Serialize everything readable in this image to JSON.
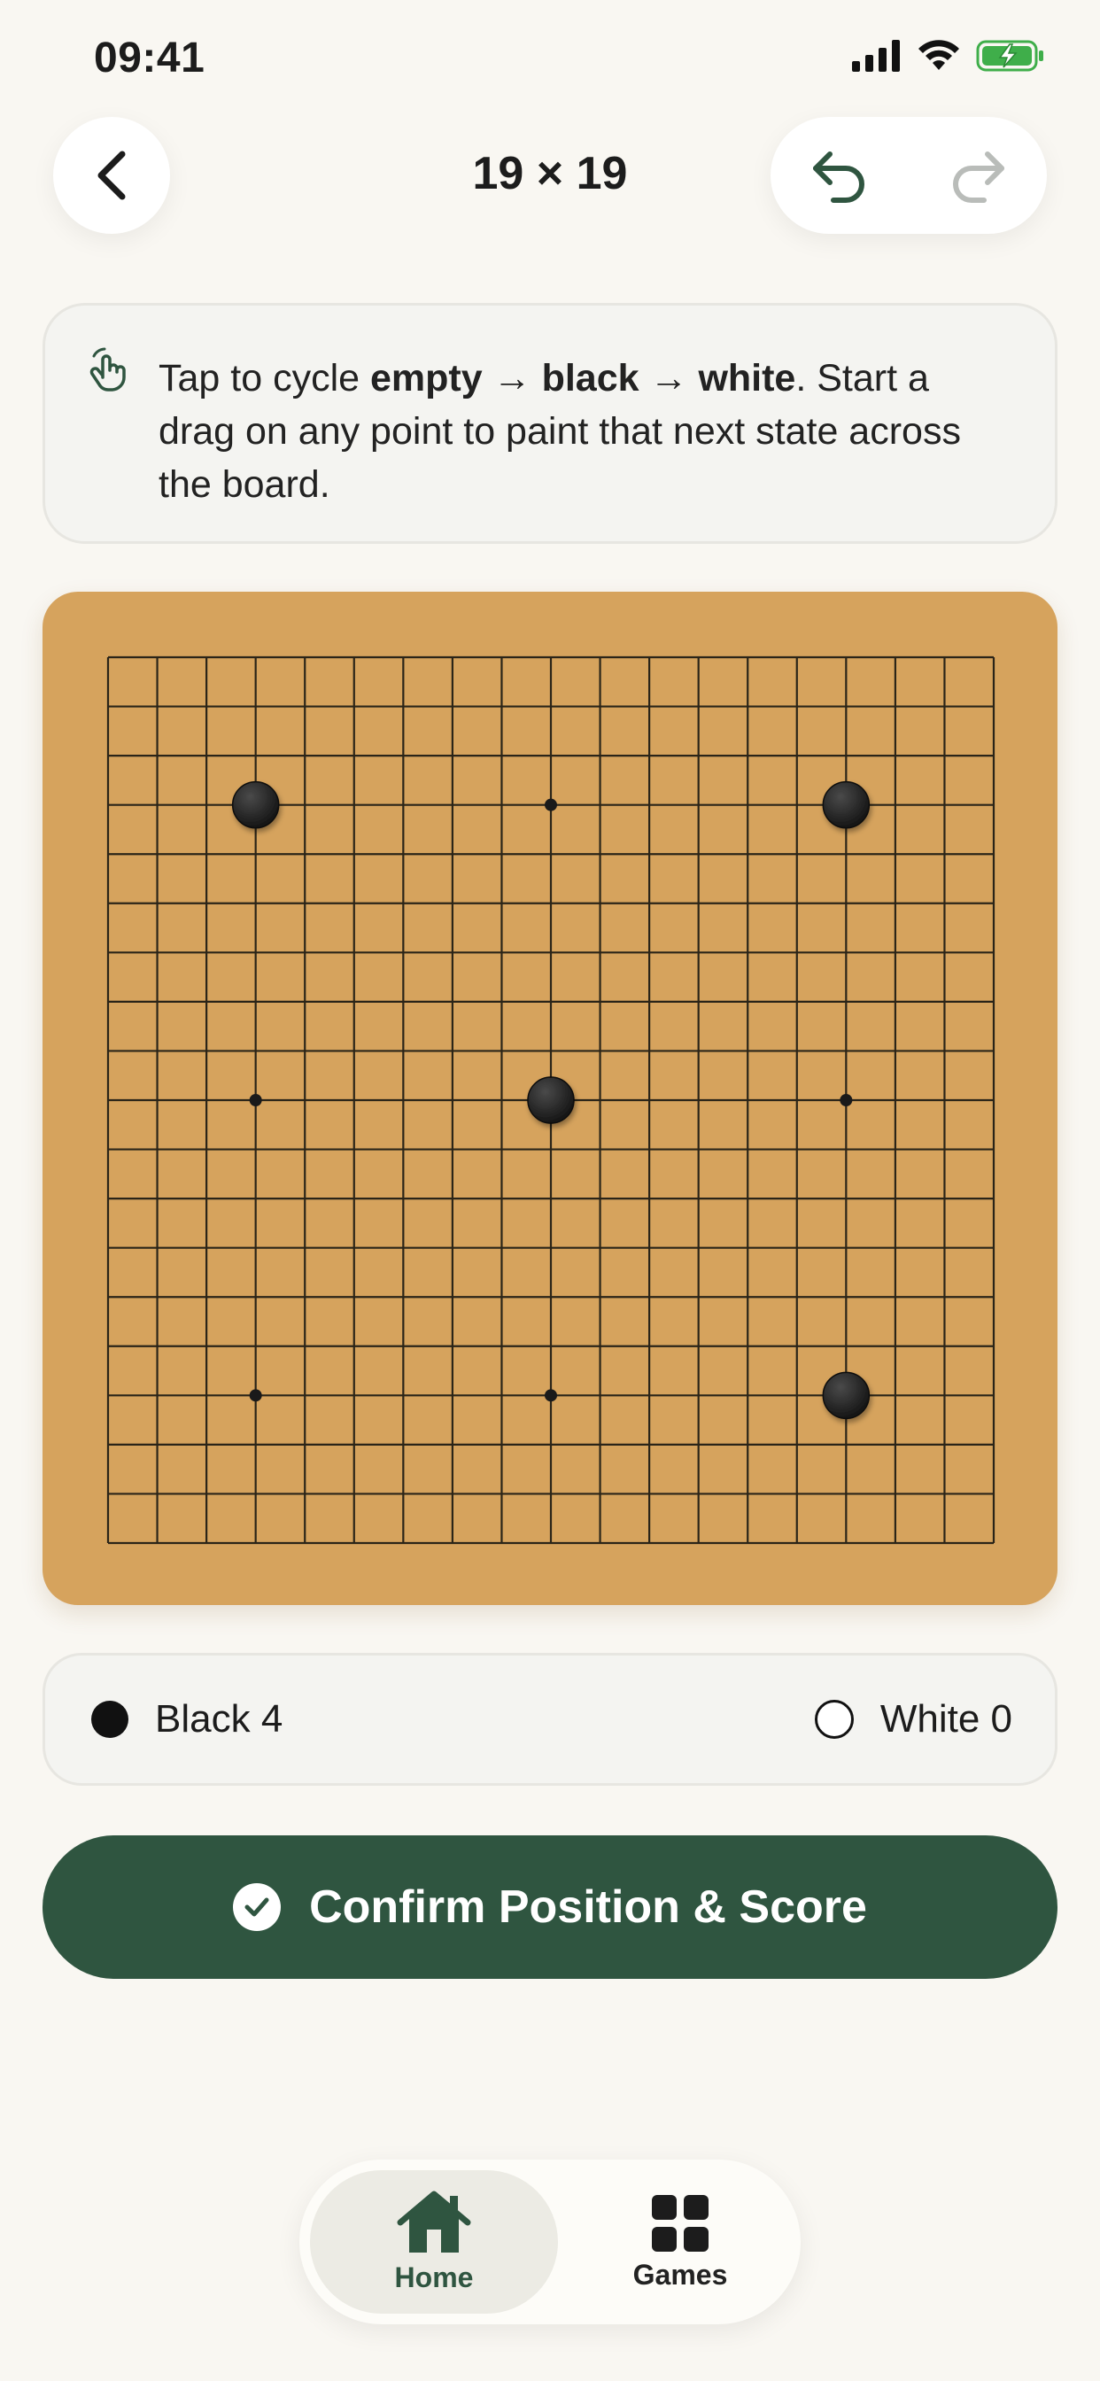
{
  "status_bar": {
    "time": "09:41"
  },
  "header": {
    "title": "19 × 19"
  },
  "hint": {
    "pre": "Tap to cycle ",
    "s1": "empty",
    "arrow1": " → ",
    "s2": "black",
    "arrow2": " → ",
    "s3": "white",
    "post": ". Start a drag on any point to paint that next state across the board."
  },
  "board": {
    "size": 19,
    "star_points": [
      [
        3,
        3
      ],
      [
        3,
        9
      ],
      [
        3,
        15
      ],
      [
        9,
        3
      ],
      [
        9,
        9
      ],
      [
        9,
        15
      ],
      [
        15,
        3
      ],
      [
        15,
        9
      ],
      [
        15,
        15
      ]
    ],
    "stones": [
      {
        "row": 3,
        "col": 3,
        "color": "black"
      },
      {
        "row": 3,
        "col": 15,
        "color": "black"
      },
      {
        "row": 9,
        "col": 9,
        "color": "black"
      },
      {
        "row": 15,
        "col": 15,
        "color": "black"
      }
    ]
  },
  "counts": {
    "black_label": "Black 4",
    "white_label": "White 0"
  },
  "confirm": {
    "label": "Confirm Position & Score"
  },
  "tabs": [
    {
      "label": "Home",
      "icon": "house-icon",
      "active": true
    },
    {
      "label": "Games",
      "icon": "grid-icon",
      "active": false
    }
  ],
  "colors": {
    "accent": "#2f5540",
    "board": "#d6a35d",
    "background": "#f9f7f2"
  }
}
